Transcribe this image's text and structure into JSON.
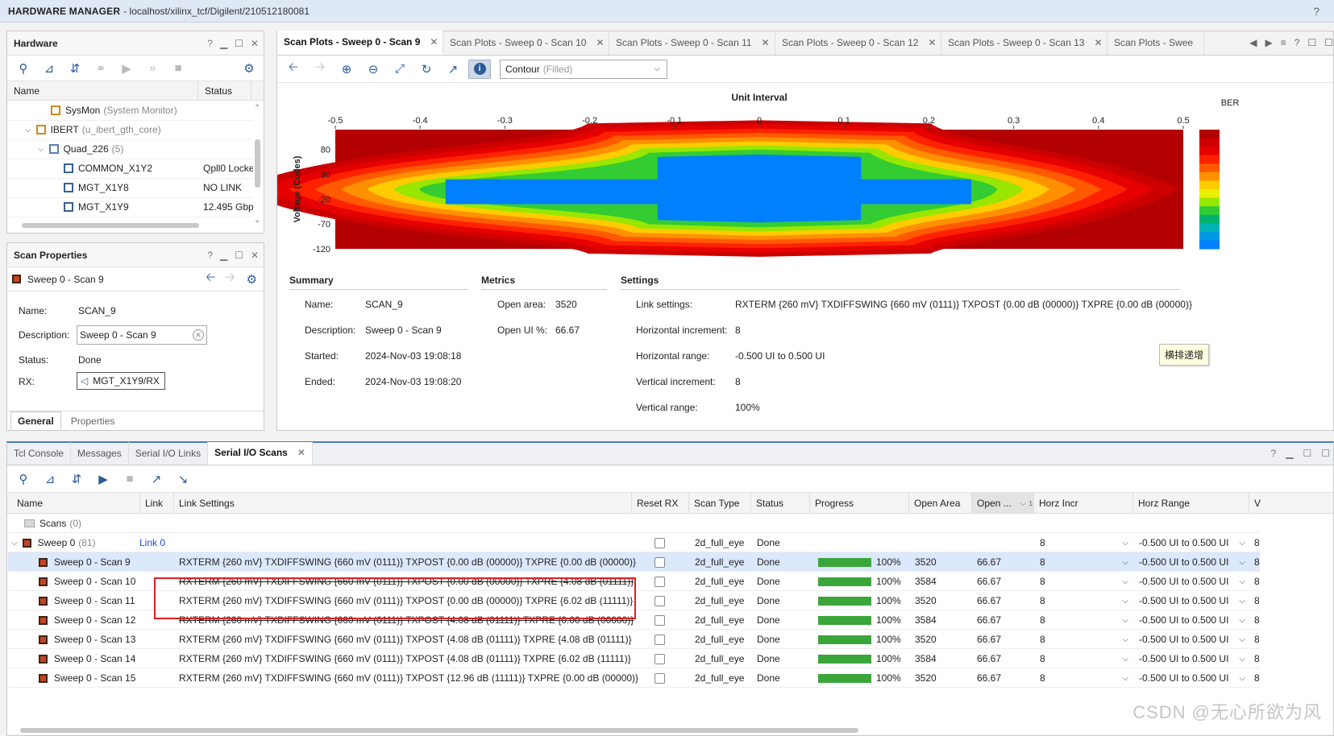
{
  "title": {
    "app": "HARDWARE MANAGER",
    "path": "- localhost/xilinx_tcf/Digilent/210512180081"
  },
  "hardware": {
    "header": "Hardware",
    "columns": [
      "Name",
      "Status"
    ],
    "rows": [
      {
        "name": "SysMon",
        "sub": "(System Monitor)",
        "status": "",
        "indent": 3,
        "icon": "sysmon-icon"
      },
      {
        "name": "IBERT",
        "sub": "(u_ibert_gth_core)",
        "status": "",
        "indent": 2,
        "icon": "ibert-icon",
        "expander": "v"
      },
      {
        "name": "Quad_226",
        "sub": "(5)",
        "status": "",
        "indent": 3,
        "icon": "quad-icon",
        "expander": "v"
      },
      {
        "name": "COMMON_X1Y2",
        "sub": "",
        "status": "Qpll0 Locke",
        "indent": 4,
        "icon": "common-icon"
      },
      {
        "name": "MGT_X1Y8",
        "sub": "",
        "status": "NO LINK",
        "indent": 4,
        "icon": "mgt-icon"
      },
      {
        "name": "MGT_X1Y9",
        "sub": "",
        "status": "12.495 Gbp",
        "indent": 4,
        "icon": "mgt-icon"
      }
    ]
  },
  "scan_props": {
    "header": "Scan Properties",
    "item": "Sweep 0 - Scan 9",
    "name_label": "Name:",
    "name_value": "SCAN_9",
    "desc_label": "Description:",
    "desc_value": "Sweep 0 - Scan 9",
    "status_label": "Status:",
    "status_value": "Done",
    "rx_label": "RX:",
    "rx_value": "MGT_X1Y9/RX",
    "tabs": [
      "General",
      "Properties"
    ]
  },
  "plot_tabs": [
    "Scan Plots - Sweep 0 - Scan 9",
    "Scan Plots - Sweep 0 - Scan 10",
    "Scan Plots - Sweep 0 - Scan 11",
    "Scan Plots - Sweep 0 - Scan 12",
    "Scan Plots - Sweep 0 - Scan 13",
    "Scan Plots - Swee"
  ],
  "plot_type": {
    "value": "Contour",
    "hint": "(Filled)"
  },
  "chart_data": {
    "type": "heatmap",
    "title": "Unit Interval",
    "ylabel": "Voltage (Codes)",
    "legend_title": "BER",
    "x_ticks": [
      "-0.5",
      "-0.4",
      "-0.3",
      "-0.2",
      "-0.1",
      "0",
      "0.1",
      "0.2",
      "0.3",
      "0.4",
      "0.5"
    ],
    "y_ticks": [
      "80",
      "30",
      "-20",
      "-70",
      "-120"
    ],
    "xlim": [
      -0.5,
      0.5
    ],
    "ylim": [
      -120,
      120
    ],
    "open_region": {
      "x_inner": [
        -0.12,
        0.12
      ],
      "x_outer": [
        -0.37,
        0.25
      ],
      "y_inner": [
        -62,
        65
      ],
      "y_outer": [
        -30,
        20
      ]
    },
    "legend_colors": [
      "#b30000",
      "#cc0000",
      "#e60000",
      "#ff2200",
      "#ff5a00",
      "#ff9000",
      "#ffcc00",
      "#e8f000",
      "#99e600",
      "#33cc33",
      "#00b36b",
      "#00b3b3",
      "#0099e6",
      "#0080ff"
    ]
  },
  "summary": {
    "title": "Summary",
    "rows": [
      [
        "Name:",
        "SCAN_9"
      ],
      [
        "Description:",
        "Sweep 0 - Scan 9"
      ],
      [
        "Started:",
        "2024-Nov-03 19:08:18"
      ],
      [
        "Ended:",
        "2024-Nov-03 19:08:20"
      ]
    ]
  },
  "metrics": {
    "title": "Metrics",
    "rows": [
      [
        "Open area:",
        "3520"
      ],
      [
        "Open UI %:",
        "66.67"
      ]
    ]
  },
  "settings": {
    "title": "Settings",
    "rows": [
      [
        "Link settings:",
        "RXTERM {260 mV} TXDIFFSWING {660 mV (0111)} TXPOST {0.00 dB (00000)} TXPRE {0.00 dB (00000)}"
      ],
      [
        "Horizontal increment:",
        "8"
      ],
      [
        "Horizontal range:",
        "-0.500 UI to 0.500 UI"
      ],
      [
        "Vertical increment:",
        "8"
      ],
      [
        "Vertical range:",
        "100%"
      ]
    ]
  },
  "tooltip": "横排递增",
  "bottom_tabs": [
    "Tcl Console",
    "Messages",
    "Serial I/O Links",
    "Serial I/O Scans"
  ],
  "scans_table": {
    "columns": [
      "Name",
      "Link",
      "Link Settings",
      "Reset RX",
      "Scan Type",
      "Status",
      "Progress",
      "Open Area",
      "Open ...",
      "Horz Incr",
      "Horz Range",
      "V"
    ],
    "sort_badge": "1",
    "scans_group": {
      "name": "Scans",
      "count": "(0)"
    },
    "sweep": {
      "name": "Sweep 0",
      "count": "(81)",
      "link": "Link 0",
      "scan_type": "2d_full_eye",
      "status": "Done",
      "horz_incr": "8",
      "horz_range": "-0.500 UI to 0.500 UI",
      "v": "8"
    },
    "rows": [
      {
        "name": "Sweep 0 - Scan 9",
        "settings": "RXTERM {260 mV} TXDIFFSWING {660 mV (0111)} TXPOST {0.00 dB (00000)} TXPRE {0.00 dB (00000)}",
        "type": "2d_full_eye",
        "status": "Done",
        "progress": "100%",
        "area": "3520",
        "open": "66.67",
        "hincr": "8",
        "hrange": "-0.500 UI to 0.500 UI",
        "v": "8",
        "strike": false
      },
      {
        "name": "Sweep 0 - Scan 10",
        "settings": "RXTERM {260 mV} TXDIFFSWING {660 mV (0111)} TXPOST {0.00 dB (00000)} TXPRE {4.08 dB (01111)}",
        "type": "2d_full_eye",
        "status": "Done",
        "progress": "100%",
        "area": "3584",
        "open": "66.67",
        "hincr": "8",
        "hrange": "-0.500 UI to 0.500 UI",
        "v": "8",
        "strike": true
      },
      {
        "name": "Sweep 0 - Scan 11",
        "settings": "RXTERM {260 mV} TXDIFFSWING {660 mV (0111)} TXPOST {0.00 dB (00000)} TXPRE {6.02 dB (11111)}",
        "type": "2d_full_eye",
        "status": "Done",
        "progress": "100%",
        "area": "3520",
        "open": "66.67",
        "hincr": "8",
        "hrange": "-0.500 UI to 0.500 UI",
        "v": "8",
        "strike": false
      },
      {
        "name": "Sweep 0 - Scan 12",
        "settings": "RXTERM {260 mV} TXDIFFSWING {660 mV (0111)} TXPOST {4.08 dB (01111)} TXPRE {0.00 dB (00000)}",
        "type": "2d_full_eye",
        "status": "Done",
        "progress": "100%",
        "area": "3584",
        "open": "66.67",
        "hincr": "8",
        "hrange": "-0.500 UI to 0.500 UI",
        "v": "8",
        "strike": true
      },
      {
        "name": "Sweep 0 - Scan 13",
        "settings": "RXTERM {260 mV} TXDIFFSWING {660 mV (0111)} TXPOST {4.08 dB (01111)} TXPRE {4.08 dB (01111)}",
        "type": "2d_full_eye",
        "status": "Done",
        "progress": "100%",
        "area": "3520",
        "open": "66.67",
        "hincr": "8",
        "hrange": "-0.500 UI to 0.500 UI",
        "v": "8",
        "strike": false
      },
      {
        "name": "Sweep 0 - Scan 14",
        "settings": "RXTERM {260 mV} TXDIFFSWING {660 mV (0111)} TXPOST {4.08 dB (01111)} TXPRE {6.02 dB (11111)}",
        "type": "2d_full_eye",
        "status": "Done",
        "progress": "100%",
        "area": "3584",
        "open": "66.67",
        "hincr": "8",
        "hrange": "-0.500 UI to 0.500 UI",
        "v": "8",
        "strike": false
      },
      {
        "name": "Sweep 0 - Scan 15",
        "settings": "RXTERM {260 mV} TXDIFFSWING {660 mV (0111)} TXPOST {12.96 dB (11111)} TXPRE {0.00 dB (00000)}",
        "type": "2d_full_eye",
        "status": "Done",
        "progress": "100%",
        "area": "3520",
        "open": "66.67",
        "hincr": "8",
        "hrange": "-0.500 UI to 0.500 UI",
        "v": "8",
        "strike": false
      }
    ]
  },
  "watermark": "CSDN @无心所欲为风",
  "colors": {
    "accent": "#2a5b9a",
    "highlight": "#e02020",
    "progress": "#3aa63a"
  }
}
